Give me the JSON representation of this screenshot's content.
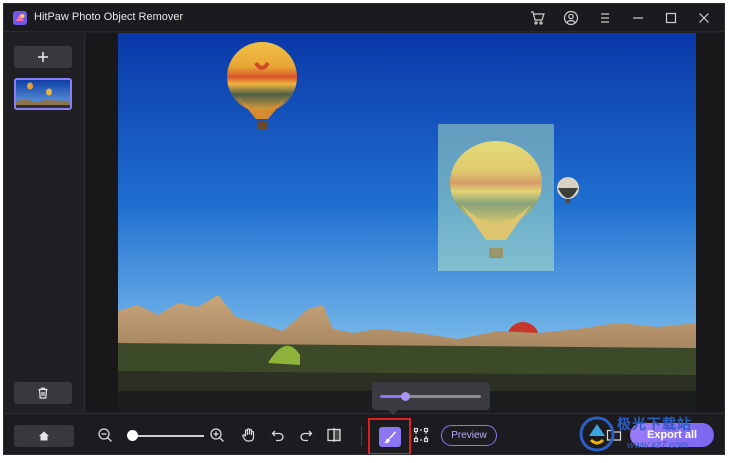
{
  "app": {
    "title": "HitPaw Photo Object Remover",
    "accent_color": "#8c76f4",
    "logo_icon": "hitpaw-logo-icon"
  },
  "titlebar": {
    "icons": [
      "cart-icon",
      "account-icon",
      "menu-icon",
      "minimize-icon",
      "maximize-icon",
      "close-icon"
    ]
  },
  "sidebar": {
    "add_icon": "plus-icon",
    "delete_icon": "trash-icon",
    "thumbnail_selected": true
  },
  "toolbar": {
    "home_icon": "home-icon",
    "zoom_out_icon": "zoom-out-icon",
    "zoom_in_icon": "zoom-in-icon",
    "zoom_level": 0.05,
    "hand_icon": "hand-icon",
    "undo_icon": "undo-icon",
    "redo_icon": "redo-icon",
    "compare_icon": "compare-icon",
    "brush_icon": "brush-icon",
    "brush_active": true,
    "box_select_icon": "box-select-icon",
    "preview_label": "Preview",
    "folder_icon": "folder-icon",
    "export_label": "Export all"
  },
  "brush_popup": {
    "size_level": 0.25
  },
  "watermark": {
    "text": "极光下载站",
    "url": "www.xz7.com"
  }
}
